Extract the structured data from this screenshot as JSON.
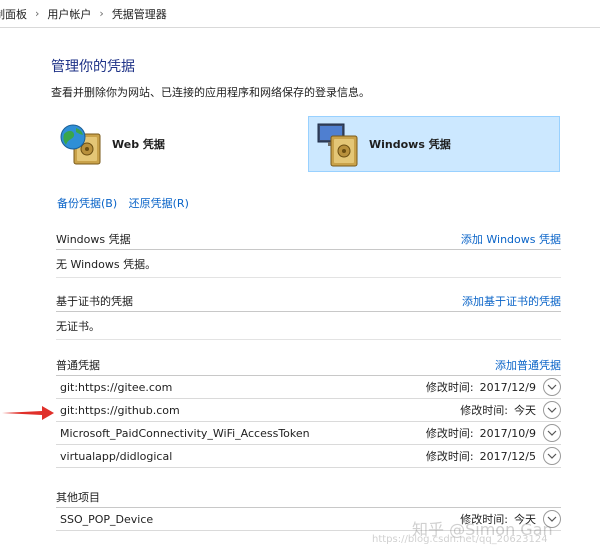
{
  "breadcrumb": {
    "items": [
      "制面板",
      "用户帐户",
      "凭据管理器"
    ],
    "separator": "›"
  },
  "header": {
    "title": "管理你的凭据",
    "description": "查看并删除你为网站、已连接的应用程序和网络保存的登录信息。"
  },
  "categories": [
    {
      "label": "Web 凭据",
      "icon": "web-credentials-icon",
      "selected": false
    },
    {
      "label": "Windows 凭据",
      "icon": "windows-credentials-icon",
      "selected": true
    }
  ],
  "actions": {
    "backup": "备份凭据(B)",
    "restore": "还原凭据(R)"
  },
  "windows_section": {
    "title": "Windows 凭据",
    "add": "添加 Windows 凭据",
    "empty": "无 Windows 凭据。"
  },
  "cert_section": {
    "title": "基于证书的凭据",
    "add": "添加基于证书的凭据",
    "empty": "无证书。"
  },
  "generic_section": {
    "title": "普通凭据",
    "add": "添加普通凭据",
    "items": [
      {
        "name": "git:https://gitee.com",
        "time_label": "修改时间:",
        "time": "2017/12/9"
      },
      {
        "name": "git:https://github.com",
        "time_label": "修改时间:",
        "time": "今天"
      },
      {
        "name": "Microsoft_PaidConnectivity_WiFi_AccessToken",
        "time_label": "修改时间:",
        "time": "2017/10/9"
      },
      {
        "name": "virtualapp/didlogical",
        "time_label": "修改时间:",
        "time": "2017/12/5"
      }
    ]
  },
  "other_section": {
    "title": "其他项目",
    "items": [
      {
        "name": "SSO_POP_Device",
        "time_label": "修改时间:",
        "time": "今天"
      }
    ]
  },
  "watermark": {
    "line1": "知乎 @Simon Gan",
    "line2": "https://blog.csdn.net/qq_20623124"
  },
  "colors": {
    "link": "#0a64c8",
    "title": "#1e3287",
    "selected_bg": "#cce8ff",
    "annotation_arrow": "#e0302a"
  }
}
